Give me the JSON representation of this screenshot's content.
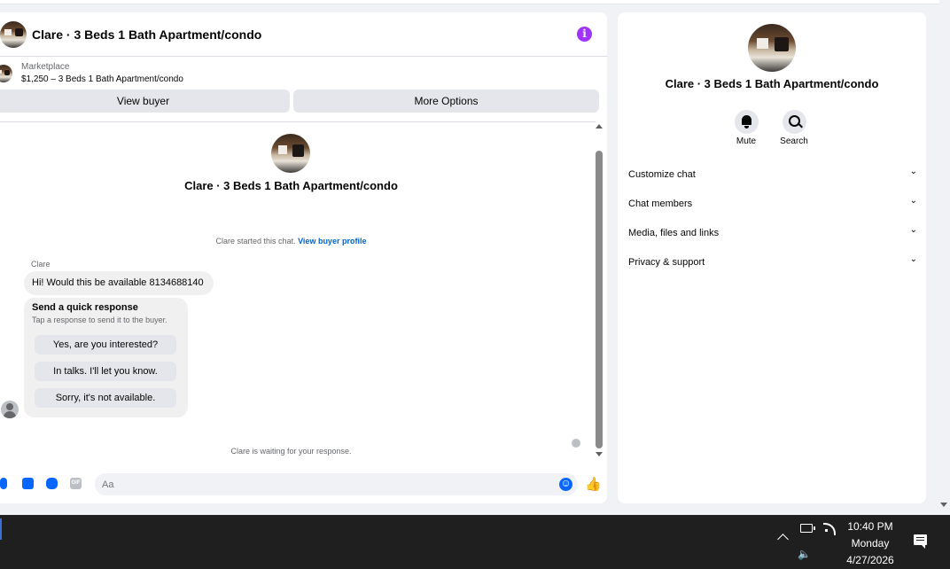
{
  "chat": {
    "title": "Clare · 3 Beds 1 Bath Apartment/condo",
    "info_icon": "info-icon",
    "marketplace_label": "Marketplace",
    "listing": "$1,250 – 3 Beds 1 Bath Apartment/condo",
    "view_buyer": "View buyer",
    "more_options": "More Options",
    "thread_title": "Clare · 3 Beds 1 Bath Apartment/condo",
    "started_text": "Clare started this chat.",
    "view_profile_link": "View buyer profile",
    "sender": "Clare",
    "message": "Hi! Would this be available 8134688140",
    "quick_title": "Send a quick response",
    "quick_sub": "Tap a response to send it to the buyer.",
    "quick_options": [
      "Yes, are you interested?",
      "In talks. I'll let you know.",
      "Sorry, it's not available."
    ],
    "waiting_text": "Clare is waiting for your response.",
    "input_placeholder": "Aa",
    "gif_label": "GIF"
  },
  "side": {
    "title": "Clare · 3 Beds 1 Bath Apartment/condo",
    "mute": "Mute",
    "search": "Search",
    "rows": [
      "Customize chat",
      "Chat members",
      "Media, files and links",
      "Privacy & support"
    ]
  },
  "taskbar": {
    "time": "10:40 PM",
    "day": "Monday",
    "date": "4/27/2026"
  },
  "colors": {
    "accent": "#0866ff",
    "info": "#a033ff",
    "link": "#0064d1",
    "taskbar": "#1f1f1f"
  }
}
